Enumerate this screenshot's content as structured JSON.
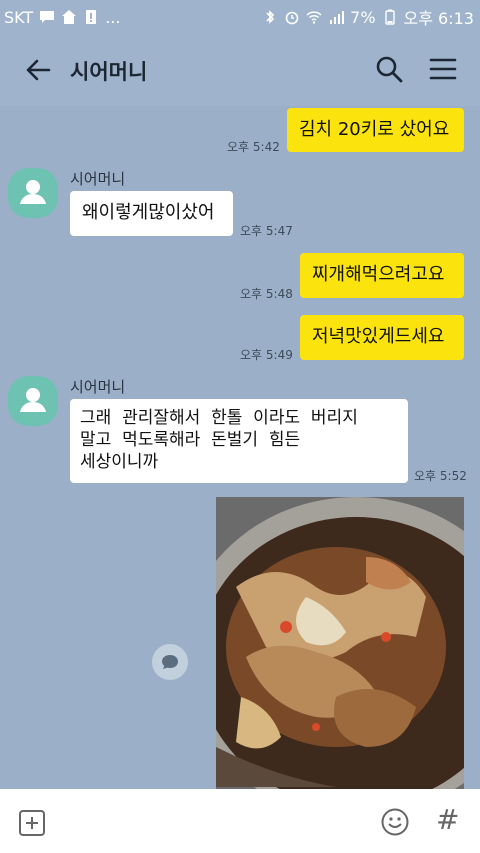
{
  "status_bar": {
    "carrier": "SKT",
    "more": "...",
    "battery": "7%",
    "time": "오후 6:13"
  },
  "header": {
    "title": "시어머니"
  },
  "messages": [
    {
      "text": "김치 20키로 샀어요",
      "time": "오후 5:42"
    },
    {
      "sender": "시어머니",
      "text": "왜이렇게많이샀어",
      "time": "오후 5:47"
    },
    {
      "text": "찌개해먹으려고요",
      "time": "오후 5:48"
    },
    {
      "text": "저녁맛있게드세요",
      "time": "오후 5:49"
    },
    {
      "sender": "시어머니",
      "line1": "그래  관리잘해서  한톨  이라도  버리지",
      "line2": "말고  먹도록해라  돈벌기  힘든",
      "line3": "세상이니까",
      "time": "오후 5:52"
    }
  ],
  "icons": {
    "back": "arrow-left-icon",
    "search": "search-icon",
    "menu": "hamburger-menu-icon",
    "plus": "plus-icon",
    "emoji": "smile-icon",
    "hash": "#"
  },
  "colors": {
    "background": "#9bb0c8",
    "my_bubble": "#fbe30d",
    "their_bubble": "#ffffff",
    "avatar": "#6ec2b2"
  }
}
